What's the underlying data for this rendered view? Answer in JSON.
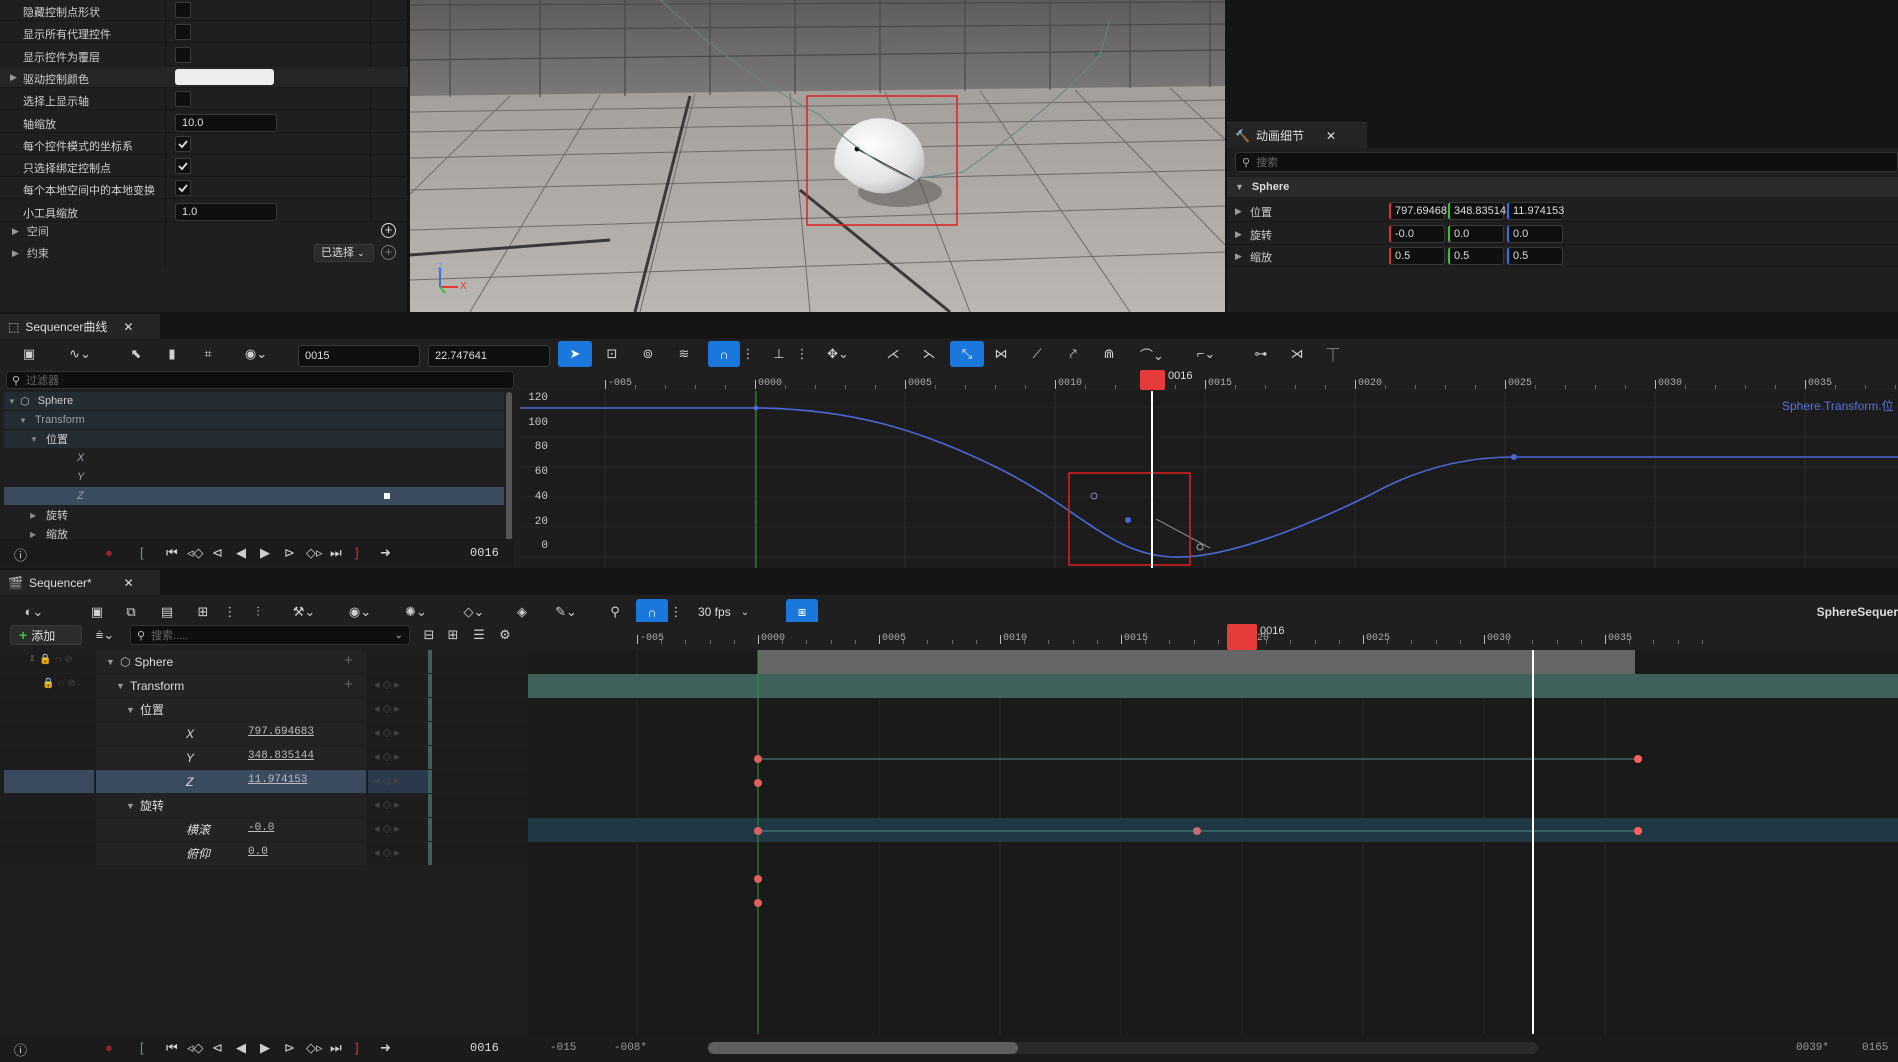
{
  "details_panel": {
    "props": [
      {
        "label": "隐藏控制点形状",
        "type": "check",
        "checked": false
      },
      {
        "label": "显示所有代理控件",
        "type": "check",
        "checked": false
      },
      {
        "label": "显示控件为覆层",
        "type": "check",
        "checked": false
      },
      {
        "label": "驱动控制颜色",
        "type": "color"
      },
      {
        "label": "选择上显示轴",
        "type": "check",
        "checked": false
      },
      {
        "label": "轴缩放",
        "type": "text",
        "value": "10.0"
      },
      {
        "label": "每个控件模式的坐标系",
        "type": "check",
        "checked": true
      },
      {
        "label": "只选择绑定控制点",
        "type": "check",
        "checked": true
      },
      {
        "label": "每个本地空间中的本地变换",
        "type": "check",
        "checked": true
      },
      {
        "label": "小工具缩放",
        "type": "text",
        "value": "1.0"
      }
    ],
    "space_label": "空间",
    "constraint_label": "约束",
    "constraint_dropdown": "已选择"
  },
  "anim_details": {
    "tab_title": "动画细节",
    "search_placeholder": "搜索",
    "object": "Sphere",
    "rows": [
      {
        "label": "位置",
        "v": [
          "797.69468",
          "348.83514",
          "11.974153"
        ]
      },
      {
        "label": "旋转",
        "v": [
          "-0.0",
          "0.0",
          "0.0"
        ]
      },
      {
        "label": "缩放",
        "v": [
          "0.5",
          "0.5",
          "0.5"
        ]
      }
    ]
  },
  "viewport": {
    "axis_x": "X",
    "axis_z": "Z"
  },
  "curve_editor": {
    "tab_title": "Sequencer曲线",
    "frame_field": "0015",
    "value_field": "22.747641",
    "filter_placeholder": "过滤器",
    "tree": [
      {
        "label": "Sphere",
        "level": 0
      },
      {
        "label": "Transform",
        "level": 1
      },
      {
        "label": "位置",
        "level": 2
      },
      {
        "label": "X",
        "level": 3
      },
      {
        "label": "Y",
        "level": 3
      },
      {
        "label": "Z",
        "level": 3
      },
      {
        "label": "旋转",
        "level": 2
      },
      {
        "label": "缩放",
        "level": 2
      }
    ],
    "frame_display": "0016",
    "ruler": [
      "-005",
      "0000",
      "0005",
      "0010",
      "0015",
      "0020",
      "0025",
      "0030",
      "0035"
    ],
    "playhead": "0016",
    "y_labels": [
      "120",
      "100",
      "80",
      "60",
      "40",
      "20",
      "0"
    ],
    "curve_name": "Sphere.Transform.位"
  },
  "sequencer": {
    "tab_title": "Sequencer*",
    "fps": "30 fps",
    "seq_name": "SphereSequer",
    "add_label": "添加",
    "search_placeholder": "搜索.....",
    "ruler": [
      "-005",
      "0000",
      "0005",
      "0010",
      "0015",
      "0020",
      "0025",
      "0030",
      "0035"
    ],
    "playhead": "0016",
    "tracks": [
      {
        "label": "Sphere",
        "value": ""
      },
      {
        "label": "Transform",
        "value": ""
      },
      {
        "label": "位置",
        "value": ""
      },
      {
        "label": "X",
        "value": "797.694683"
      },
      {
        "label": "Y",
        "value": "348.835144"
      },
      {
        "label": "Z",
        "value": "11.974153"
      },
      {
        "label": "旋转",
        "value": ""
      },
      {
        "label": "横滚",
        "value": "-0.0"
      },
      {
        "label": "俯仰",
        "value": "0.0"
      }
    ],
    "frame_display": "0016",
    "bottom_left1": "-015",
    "bottom_left2": "-008*",
    "bottom_right1": "0039*",
    "bottom_right2": "0165"
  }
}
